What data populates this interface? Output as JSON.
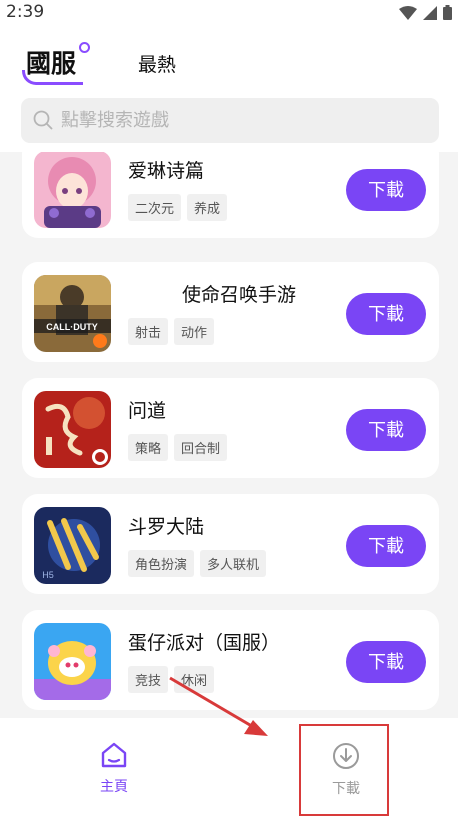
{
  "status_bar": {
    "time": "2:39"
  },
  "header": {
    "tabs": [
      {
        "label": "國服",
        "active": true
      },
      {
        "label": "最熱",
        "active": false
      }
    ],
    "search": {
      "placeholder": "點擊搜索遊戲"
    }
  },
  "games": [
    {
      "title": "爱琳诗篇",
      "tags": [
        "二次元",
        "养成"
      ],
      "button": "下載",
      "icon": "anime-girl-icon"
    },
    {
      "title": "使命召唤手游",
      "tags": [
        "射击",
        "动作"
      ],
      "button": "下載",
      "icon": "call-of-duty-icon"
    },
    {
      "title": "问道",
      "tags": [
        "策略",
        "回合制"
      ],
      "button": "下載",
      "icon": "wendao-icon"
    },
    {
      "title": "斗罗大陆",
      "tags": [
        "角色扮演",
        "多人联机"
      ],
      "button": "下載",
      "icon": "douluo-icon"
    },
    {
      "title": "蛋仔派对（国服）",
      "tags": [
        "竞技",
        "休闲"
      ],
      "button": "下載",
      "icon": "eggy-party-icon"
    }
  ],
  "bottom_nav": {
    "home": {
      "label": "主頁",
      "active": true
    },
    "download": {
      "label": "下載",
      "active": false
    }
  },
  "colors": {
    "accent": "#7a45f5",
    "annotation": "#d83a3a"
  }
}
